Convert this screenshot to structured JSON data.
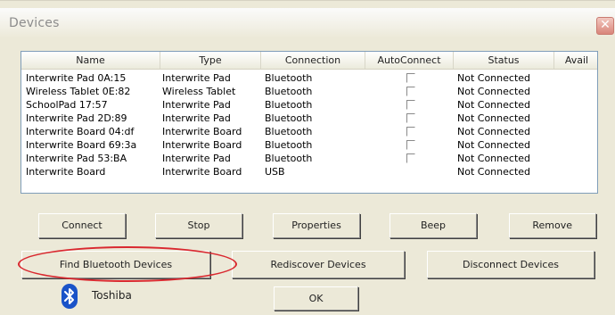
{
  "window": {
    "title": "Devices",
    "close_glyph": "✕"
  },
  "table": {
    "columns": [
      "Name",
      "Type",
      "Connection",
      "AutoConnect",
      "Status",
      "Avail"
    ],
    "rows": [
      {
        "name": "Interwrite Pad 0A:15",
        "type": "Interwrite Pad",
        "connection": "Bluetooth",
        "autoconnect": false,
        "status": "Not Connected"
      },
      {
        "name": "Wireless Tablet 0E:82",
        "type": "Wireless Tablet",
        "connection": "Bluetooth",
        "autoconnect": false,
        "status": "Not Connected"
      },
      {
        "name": "SchoolPad 17:57",
        "type": "Interwrite Pad",
        "connection": "Bluetooth",
        "autoconnect": false,
        "status": "Not Connected"
      },
      {
        "name": "Interwrite Pad 2D:89",
        "type": "Interwrite Pad",
        "connection": "Bluetooth",
        "autoconnect": false,
        "status": "Not Connected"
      },
      {
        "name": "Interwrite Board 04:df",
        "type": "Interwrite Board",
        "connection": "Bluetooth",
        "autoconnect": false,
        "status": "Not Connected"
      },
      {
        "name": "Interwrite Board 69:3a",
        "type": "Interwrite Board",
        "connection": "Bluetooth",
        "autoconnect": false,
        "status": "Not Connected"
      },
      {
        "name": "Interwrite Pad 53:BA",
        "type": "Interwrite Pad",
        "connection": "Bluetooth",
        "autoconnect": false,
        "status": "Not Connected"
      },
      {
        "name": "Interwrite Board",
        "type": "Interwrite Board",
        "connection": "USB",
        "autoconnect": null,
        "status": "Not Connected"
      }
    ]
  },
  "buttons": {
    "connect": "Connect",
    "stop": "Stop",
    "properties": "Properties",
    "beep": "Beep",
    "remove": "Remove",
    "find_bluetooth": "Find Bluetooth Devices",
    "rediscover": "Rediscover Devices",
    "disconnect": "Disconnect Devices",
    "ok": "OK"
  },
  "bluetooth_stack": {
    "icon": "bluetooth-icon",
    "label": "Toshiba"
  },
  "highlight": {
    "annotation": "red-ellipse-around-find-bluetooth-button",
    "color": "#d9282f"
  }
}
